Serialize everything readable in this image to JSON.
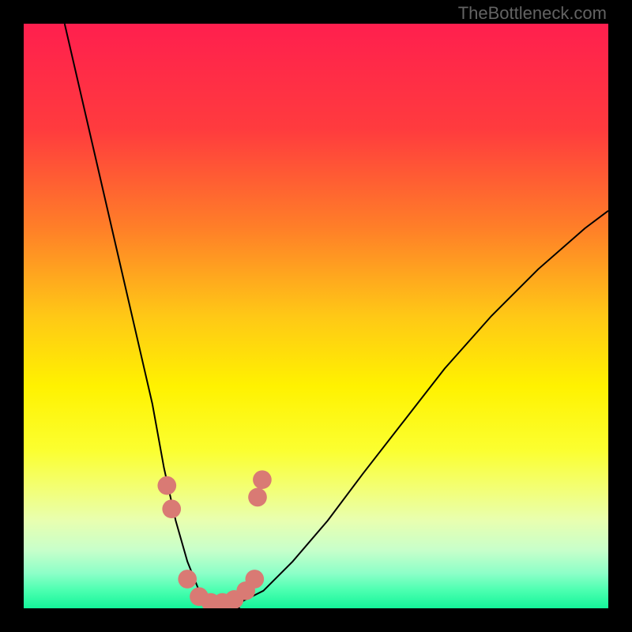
{
  "watermark": "TheBottleneck.com",
  "gradient_stops": [
    {
      "offset": 0,
      "color": "#ff1f4e"
    },
    {
      "offset": 18,
      "color": "#ff3b3e"
    },
    {
      "offset": 35,
      "color": "#ff7f28"
    },
    {
      "offset": 50,
      "color": "#ffc816"
    },
    {
      "offset": 62,
      "color": "#fff200"
    },
    {
      "offset": 73,
      "color": "#fbff30"
    },
    {
      "offset": 80,
      "color": "#f2ff7a"
    },
    {
      "offset": 85,
      "color": "#e8ffb0"
    },
    {
      "offset": 90,
      "color": "#c8ffca"
    },
    {
      "offset": 94,
      "color": "#8dffc8"
    },
    {
      "offset": 97,
      "color": "#4affb0"
    },
    {
      "offset": 100,
      "color": "#14f59a"
    }
  ],
  "chart_data": {
    "type": "line",
    "title": "",
    "xlabel": "",
    "ylabel": "",
    "xlim": [
      0,
      100
    ],
    "ylim": [
      0,
      100
    ],
    "series": [
      {
        "name": "left-curve",
        "x": [
          7,
          10,
          13,
          16,
          19,
          22,
          24,
          26,
          28,
          30,
          33,
          37
        ],
        "y": [
          100,
          87,
          74,
          61,
          48,
          35,
          24,
          15,
          8,
          3,
          1,
          0
        ]
      },
      {
        "name": "right-curve",
        "x": [
          33,
          37,
          41,
          46,
          52,
          58,
          65,
          72,
          80,
          88,
          96,
          100
        ],
        "y": [
          0,
          1,
          3,
          8,
          15,
          23,
          32,
          41,
          50,
          58,
          65,
          68
        ]
      }
    ],
    "markers": {
      "name": "salmon-dots",
      "color": "#d97a74",
      "points": [
        {
          "x": 24.5,
          "y": 21
        },
        {
          "x": 25.3,
          "y": 17
        },
        {
          "x": 28.0,
          "y": 5
        },
        {
          "x": 30.0,
          "y": 2
        },
        {
          "x": 32.0,
          "y": 1
        },
        {
          "x": 34.0,
          "y": 1
        },
        {
          "x": 36.0,
          "y": 1.5
        },
        {
          "x": 38.0,
          "y": 3
        },
        {
          "x": 39.5,
          "y": 5
        },
        {
          "x": 40.0,
          "y": 19
        },
        {
          "x": 40.8,
          "y": 22
        }
      ]
    }
  }
}
